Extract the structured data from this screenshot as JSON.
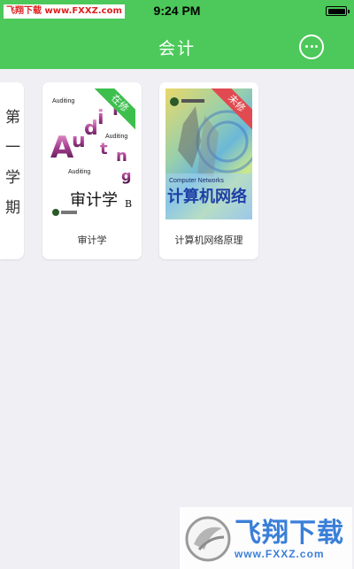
{
  "status_bar": {
    "watermark_text": "飞翔下载 www.FXXZ.com",
    "time": "9:24 PM"
  },
  "nav": {
    "title": "会计",
    "more_icon": "more-circle-icon"
  },
  "semester": {
    "label": "第一学期"
  },
  "courses": [
    {
      "name": "审计学",
      "status": "在修",
      "status_color": "#3dbf4e",
      "cover": {
        "letters": [
          "A",
          "u",
          "d",
          "i",
          "t",
          "i",
          "n",
          "g"
        ],
        "small_texts": [
          "Auditing",
          "Auditing",
          "Auditing"
        ],
        "title": "审计学",
        "edition": "B"
      }
    },
    {
      "name": "计算机网络原理",
      "status": "未修",
      "status_color": "#e04a50",
      "cover": {
        "title": "计算机网络",
        "subtitle": "Computer Networks"
      }
    }
  ],
  "watermark": {
    "main": "飞翔下载",
    "sub": "www.FXXZ.com"
  },
  "colors": {
    "accent": "#4cc95a",
    "background": "#efeff4"
  }
}
